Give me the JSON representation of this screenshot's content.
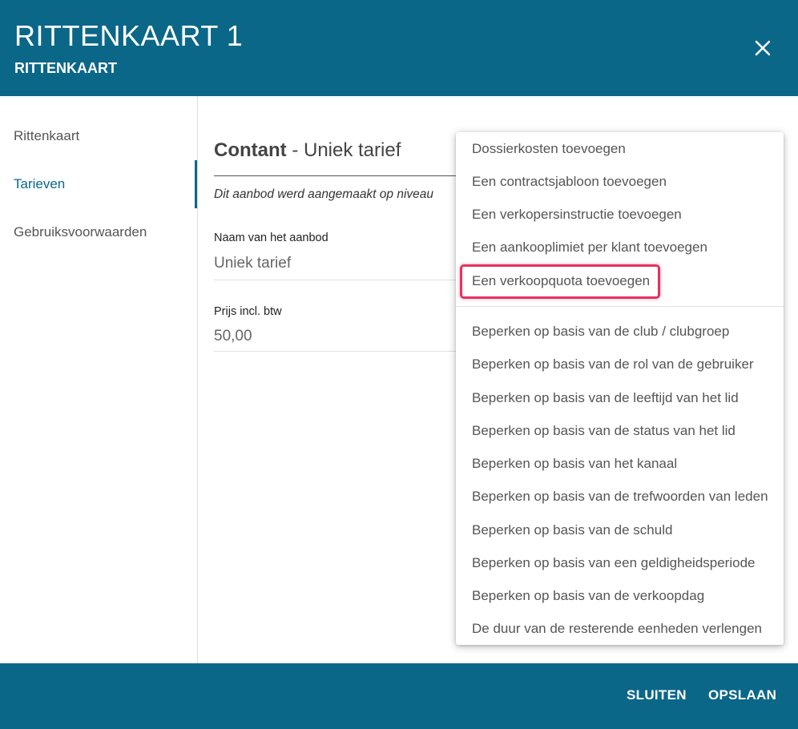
{
  "header": {
    "title": "RITTENKAART 1",
    "subtitle": "RITTENKAART",
    "close_icon": "close-icon",
    "background": "#0b6788"
  },
  "sidebar": {
    "items": [
      {
        "label": "Rittenkaart",
        "active": false
      },
      {
        "label": "Tarieven",
        "active": true
      },
      {
        "label": "Gebruiksvoorwaarden",
        "active": false
      }
    ]
  },
  "main": {
    "section_title_bold": "Contant",
    "section_title_rest": " - Uniek tarief",
    "note": "Dit aanbod werd aangemaakt op niveau",
    "fields": [
      {
        "label": "Naam van het aanbod",
        "value": "Uniek tarief"
      },
      {
        "label": "Prijs incl. btw",
        "value": "50,00"
      }
    ]
  },
  "menu": {
    "group1": [
      "Dossierkosten toevoegen",
      "Een contractsjabloon toevoegen",
      "Een verkopersinstructie toevoegen",
      "Een aankooplimiet per klant toevoegen",
      "Een verkoopquota toevoegen"
    ],
    "group2": [
      "Beperken op basis van de club / clubgroep",
      "Beperken op basis van de rol van de gebruiker",
      "Beperken op basis van de leeftijd van het lid",
      "Beperken op basis van de status van het lid",
      "Beperken op basis van het kanaal",
      "Beperken op basis van de trefwoorden van leden",
      "Beperken op basis van de schuld",
      "Beperken op basis van een geldigheidsperiode",
      "Beperken op basis van de verkoopdag",
      "De duur van de resterende eenheden verlengen"
    ],
    "highlighted_item": "Een verkoopquota toevoegen",
    "highlight_color": "#e5325f"
  },
  "footer": {
    "close_label": "SLUITEN",
    "save_label": "OPSLAAN"
  }
}
